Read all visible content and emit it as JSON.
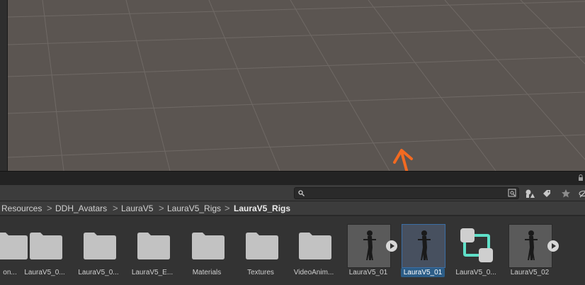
{
  "search": {
    "value": "",
    "placeholder": ""
  },
  "toolbar": {
    "search_icon": "search-icon",
    "filter_icon": "search-by-type-icon",
    "buttons": [
      "filter-by-type-icon",
      "filter-by-label-icon",
      "favorites-star-icon",
      "hidden-packages-icon"
    ]
  },
  "breadcrumb": {
    "items": [
      "Resources",
      "DDH_Avatars",
      "LauraV5",
      "LauraV5_Rigs",
      "LauraV5_Rigs"
    ],
    "separator": ">"
  },
  "assets": [
    {
      "label": "on...",
      "kind": "folder"
    },
    {
      "label": "LauraV5_0...",
      "kind": "folder"
    },
    {
      "label": "LauraV5_0...",
      "kind": "folder"
    },
    {
      "label": "LauraV5_E...",
      "kind": "folder"
    },
    {
      "label": "Materials",
      "kind": "folder"
    },
    {
      "label": "Textures",
      "kind": "folder"
    },
    {
      "label": "VideoAnim...",
      "kind": "folder"
    },
    {
      "label": "LauraV5_01",
      "kind": "model"
    },
    {
      "label": "LauraV5_01",
      "kind": "avatar",
      "selected": true
    },
    {
      "label": "LauraV5_0...",
      "kind": "animator-controller"
    },
    {
      "label": "LauraV5_02",
      "kind": "model"
    }
  ],
  "colors": {
    "scene_background": "#5b5551",
    "annotation_arrow": "#f26a21",
    "selection": "#2c5d87",
    "controller_accent": "#5fe0c8"
  }
}
